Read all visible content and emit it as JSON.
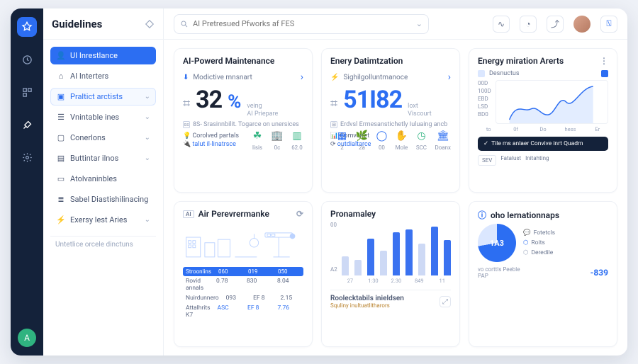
{
  "app": {
    "title": "Guidelines"
  },
  "search": {
    "placeholder": "AI Pretresued Pfworks af FES"
  },
  "sidebar": {
    "items": [
      {
        "label": "UI Inrestlance"
      },
      {
        "label": "AI Interters"
      },
      {
        "label": "Praltict arctists"
      },
      {
        "label": "Vnintable ines"
      },
      {
        "label": "Conerlons"
      },
      {
        "label": "Buttintar ilnos"
      },
      {
        "label": "Atolvaninbles"
      },
      {
        "label": "Sabel Diastishilinacing"
      },
      {
        "label": "Exersy lest Aries"
      }
    ],
    "note": "Untetlice orcele dinctuns"
  },
  "cards": {
    "maint": {
      "title": "AI-Powerd Maintenance",
      "sub": "Modictive mnsnart",
      "value": "32",
      "pct": "%",
      "cap1": "veing",
      "cap2": "AI Priepare",
      "note": "8S- Srasinnbilit. Togarce on unersices",
      "links": {
        "a": "Corolved partals",
        "b": "talut il-linatrsce"
      },
      "cols": [
        "lisis",
        "0c",
        "62.0"
      ]
    },
    "energy": {
      "title": "Enery Datimtzation",
      "sub": "Sighilgolluntmanoce",
      "value": "51I82",
      "cap1": "loxt",
      "cap2": "Viscourt",
      "note": "Erdvsl Ermesanstichetly Iuluaing ancb",
      "links": {
        "a": "Comverret",
        "b": "outdialtarce"
      },
      "cols": [
        "2",
        "2a",
        "00",
        "Mole",
        "SCC",
        "Doanx"
      ]
    },
    "alerts": {
      "title": "Energy miration Arerts",
      "legend": "Desnuctus",
      "ylabels": [
        "00D",
        "100D",
        "EBD",
        "LSD",
        "BD0"
      ],
      "xlabels": [
        "to",
        "0f",
        "Do",
        "hess",
        "Er"
      ],
      "button": "Tile ms anlaer Convive inrt Quadrn",
      "tags": [
        "SEV",
        "Fatalust",
        "Initahting"
      ]
    },
    "perf": {
      "title": "Air Perevrermanke",
      "headers": [
        "Stroonlins",
        "060",
        "019",
        "050"
      ],
      "rows": [
        [
          "Rovid annals",
          "0.78",
          "830",
          "8.04"
        ],
        [
          "Nuirdunnero",
          "093",
          "EF 8",
          "2.15"
        ],
        [
          "Attalhrits K7",
          "ASC",
          "EF 8",
          "7.76"
        ]
      ]
    },
    "prog": {
      "title": "Pronamaley",
      "ylabels": [
        "00",
        "A2"
      ],
      "xlabels": [
        "27",
        "1:30",
        "2.30",
        "849",
        "11"
      ],
      "sub_title": "Roolecktabils inieldsen",
      "sub_caption": "Squliny inultuatlitharors"
    },
    "info": {
      "title": "oho lernationnaps",
      "pie_label": "1A3",
      "legend": [
        "Fotetcls",
        "Roits",
        "Deredile"
      ],
      "stat_label": "vo corttls Peeble",
      "stat_note": "PAP",
      "stat_value": "-839"
    }
  },
  "chart_data": [
    {
      "type": "line",
      "title": "Energy miration Arerts",
      "y_ticks": [
        "00D",
        "100D",
        "EBD",
        "LSD",
        "BD0"
      ],
      "x_ticks": [
        "to",
        "0f",
        "Do",
        "hess",
        "Er"
      ],
      "series": [
        {
          "name": "Desnuctus",
          "values": [
            40,
            55,
            35,
            30,
            70,
            60,
            90
          ]
        }
      ]
    },
    {
      "type": "bar",
      "title": "Pronamaley",
      "categories": [
        "27",
        "1:30",
        "2.30",
        "849",
        "11"
      ],
      "series": [
        {
          "name": "a",
          "values": [
            38,
            30,
            72,
            48,
            85,
            90,
            62,
            96,
            70
          ]
        },
        {
          "name": "style",
          "values": [
            "lite",
            "lite",
            "solid",
            "lite",
            "solid",
            "solid",
            "lite",
            "solid",
            "solid"
          ]
        }
      ]
    },
    {
      "type": "pie",
      "title": "oho lernationnaps",
      "slices": [
        {
          "name": "primary",
          "value": 72
        },
        {
          "name": "rest",
          "value": 28
        }
      ],
      "center_label": "1A3"
    }
  ]
}
